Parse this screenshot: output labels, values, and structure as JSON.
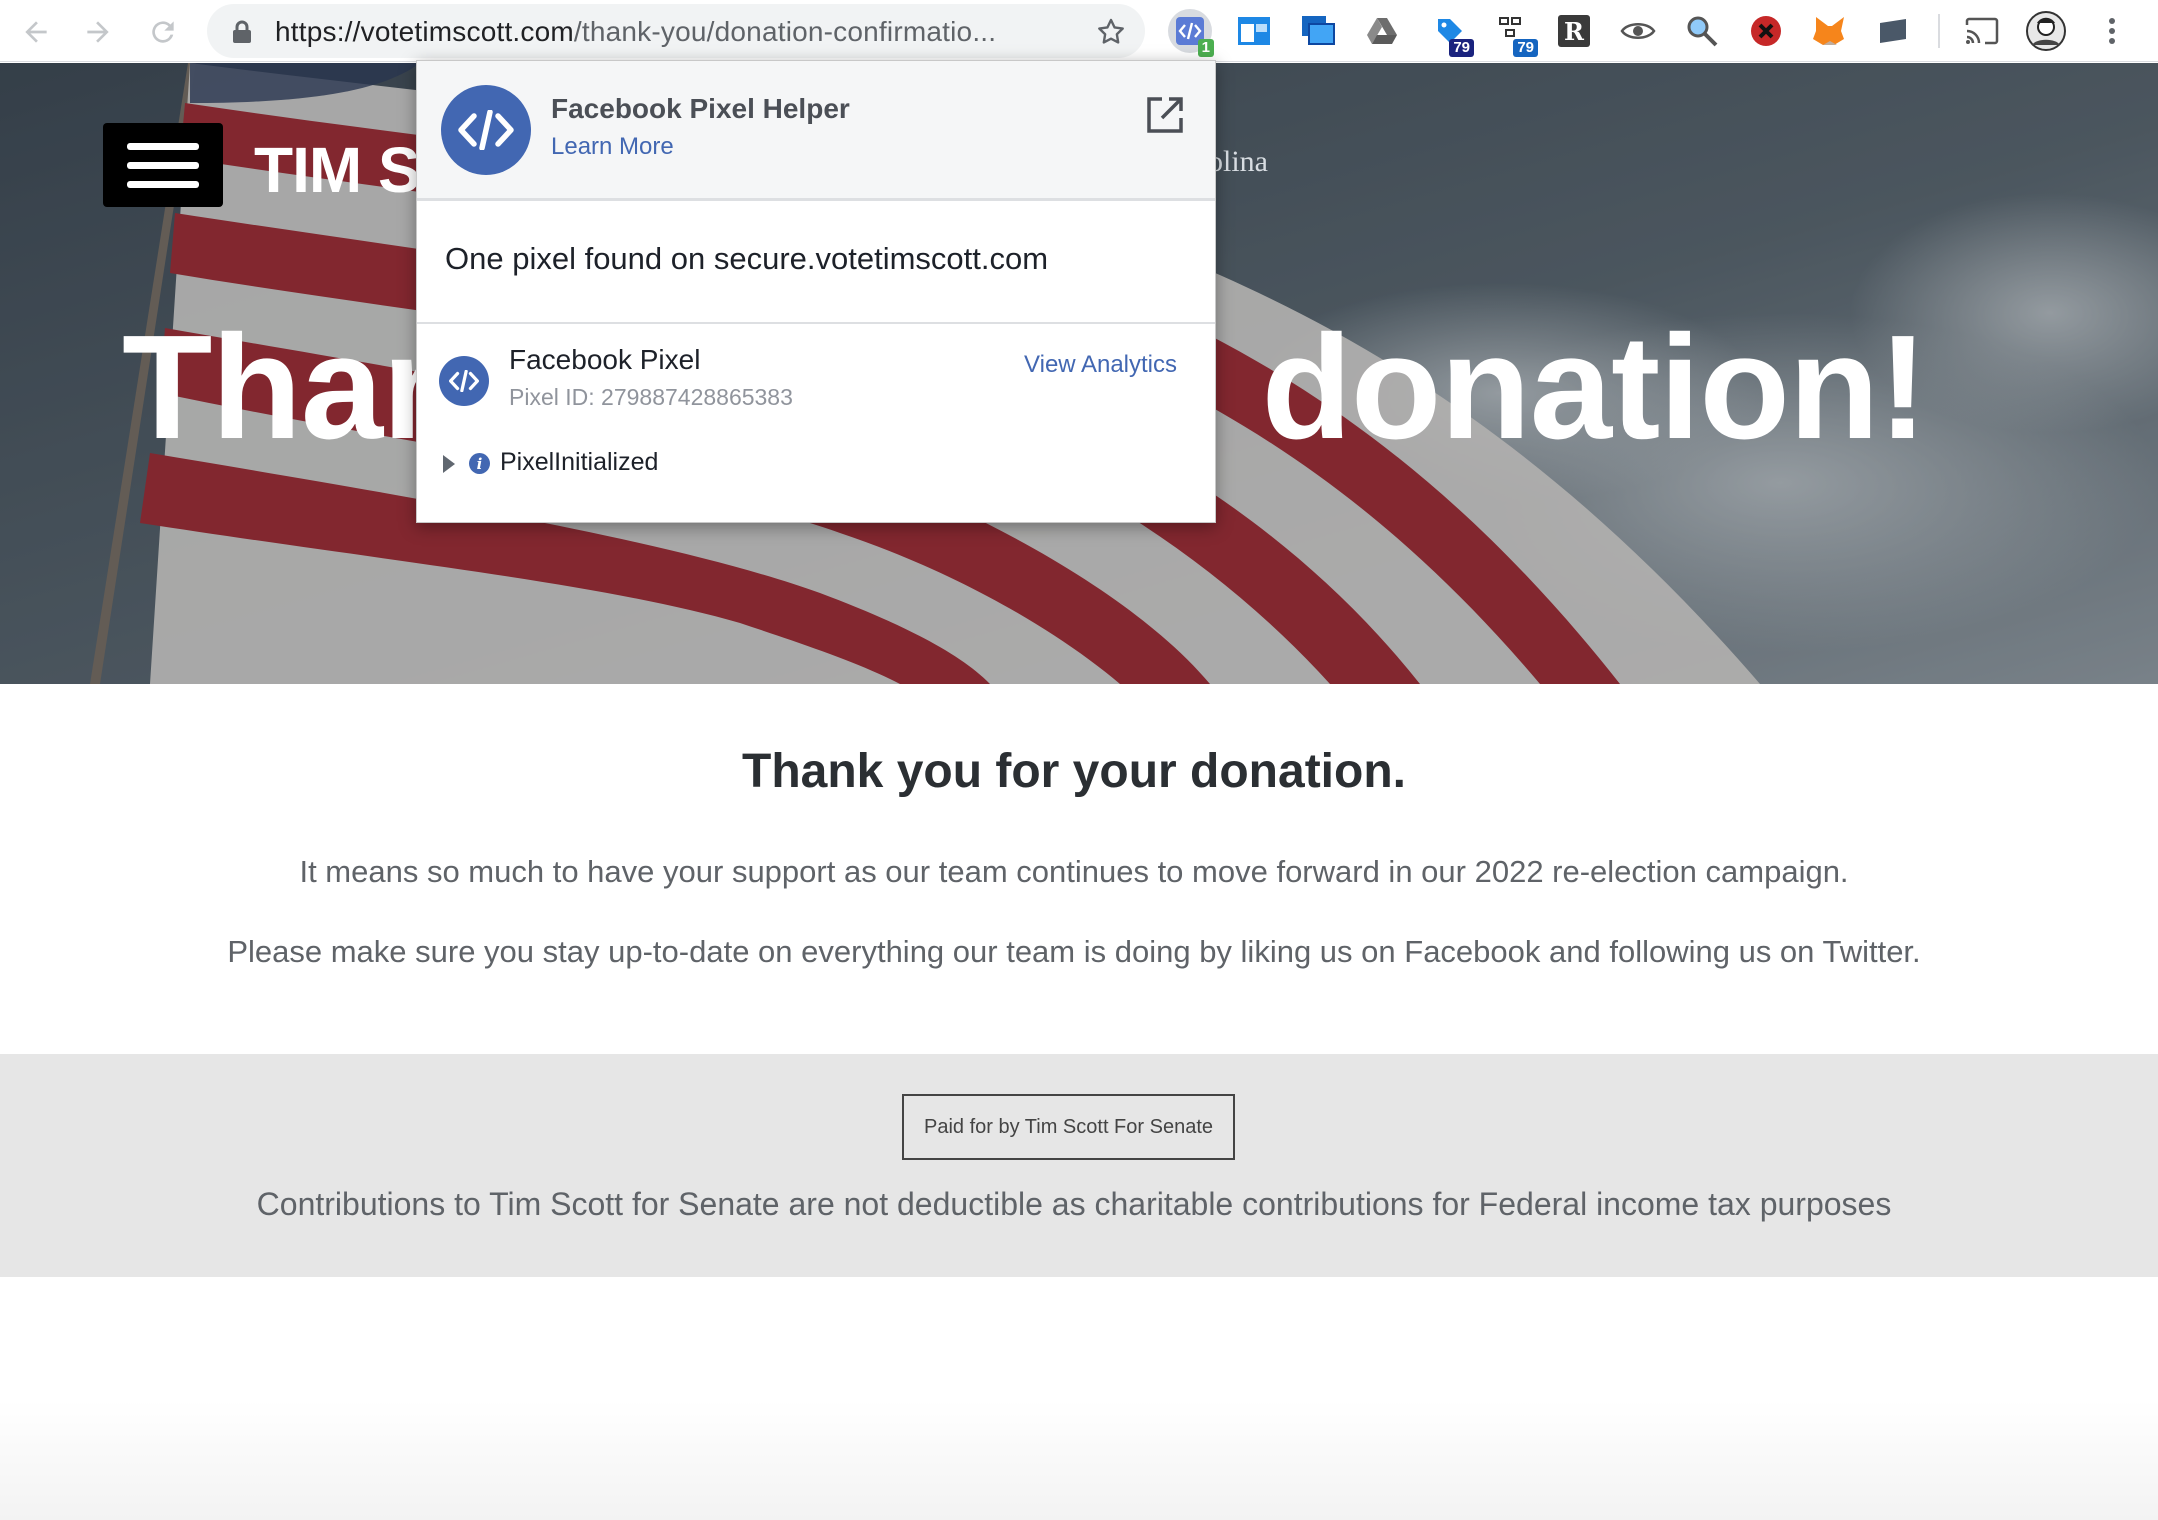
{
  "browser": {
    "url_host": "https://votetimscott.com",
    "url_path": "/thank-you/donation-confirmatio...",
    "extensions": [
      {
        "name": "facebook-pixel-helper",
        "badge": "1",
        "badge_color": "#4caf50"
      },
      {
        "name": "window-icon"
      },
      {
        "name": "screenshot-icon"
      },
      {
        "name": "drive-icon"
      },
      {
        "name": "ext-79-a",
        "badge": "79",
        "badge_color": "#1a237e"
      },
      {
        "name": "ext-79-b",
        "badge": "79",
        "badge_color": "#1565c0"
      },
      {
        "name": "r-icon"
      },
      {
        "name": "eye-icon"
      },
      {
        "name": "magnifier-icon"
      },
      {
        "name": "blocker-icon"
      },
      {
        "name": "metamask-icon"
      },
      {
        "name": "card-icon"
      }
    ]
  },
  "site": {
    "title": "TIM SC",
    "subtitle": "olina",
    "hero_left": "Than",
    "hero_right": "donation!"
  },
  "content": {
    "heading": "Thank you for your donation.",
    "para1": "It means so much to have your support as our team continues to move forward in our 2022 re-election campaign.",
    "para2": "Please make sure you stay up-to-date on everything our team is doing by liking us on Facebook and following us on Twitter."
  },
  "footer": {
    "paid_for": "Paid for by Tim Scott For Senate",
    "disclaimer": "Contributions to Tim Scott for Senate are not deductible as charitable contributions for Federal income tax purposes"
  },
  "pixel_helper": {
    "title": "Facebook Pixel Helper",
    "learn_more": "Learn More",
    "found_text": "One pixel found on secure.votetimscott.com",
    "pixel_name": "Facebook Pixel",
    "pixel_id": "Pixel ID: 279887428865383",
    "view_analytics": "View Analytics",
    "event": "PixelInitialized"
  },
  "colors": {
    "facebook_blue": "#4267b2",
    "flag_red": "#b22234"
  }
}
